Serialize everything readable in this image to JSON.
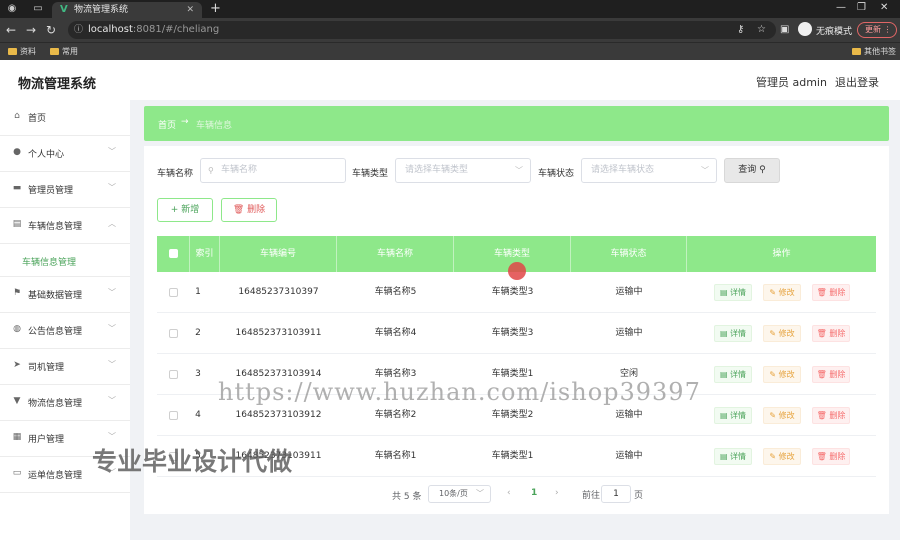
{
  "browser": {
    "tab_title": "物流管理系统",
    "url_host": "localhost",
    "url_path": ":8081/#/cheliang",
    "incognito_label": "无痕模式",
    "update_label": "更新",
    "bookmarks": [
      "资料",
      "常用",
      "其他书签"
    ]
  },
  "header": {
    "app_title": "物流管理系统",
    "user_label": "管理员 admin",
    "logout_label": "退出登录"
  },
  "sidebar": {
    "items": [
      {
        "label": "首页",
        "icon": "home-icon"
      },
      {
        "label": "个人中心",
        "icon": "user-icon"
      },
      {
        "label": "管理员管理",
        "icon": "briefcase-icon"
      },
      {
        "label": "车辆信息管理",
        "icon": "chat-icon"
      },
      {
        "label": "基础数据管理",
        "icon": "flag-icon"
      },
      {
        "label": "公告信息管理",
        "icon": "location-icon"
      },
      {
        "label": "司机管理",
        "icon": "send-icon"
      },
      {
        "label": "物流信息管理",
        "icon": "sign-icon"
      },
      {
        "label": "用户管理",
        "icon": "document-icon"
      },
      {
        "label": "运单信息管理",
        "icon": "ticket-icon"
      }
    ],
    "active_sub": "车辆信息管理"
  },
  "breadcrumb": {
    "home": "首页",
    "separator": "→",
    "current": "车辆信息"
  },
  "filters": {
    "name_label": "车辆名称",
    "name_placeholder": "车辆名称",
    "type_label": "车辆类型",
    "type_placeholder": "请选择车辆类型",
    "status_label": "车辆状态",
    "status_placeholder": "请选择车辆状态",
    "query_label": "查询"
  },
  "actions": {
    "add_label": "新增",
    "delete_label": "删除"
  },
  "table": {
    "headers": [
      "索引",
      "车辆编号",
      "车辆名称",
      "车辆类型",
      "车辆状态",
      "操作"
    ],
    "rows": [
      {
        "index": "1",
        "code": "16485237310397",
        "name": "车辆名称5",
        "type": "车辆类型3",
        "status": "运输中"
      },
      {
        "index": "2",
        "code": "164852373103911",
        "name": "车辆名称4",
        "type": "车辆类型3",
        "status": "运输中"
      },
      {
        "index": "3",
        "code": "164852373103914",
        "name": "车辆名称3",
        "type": "车辆类型1",
        "status": "空闲"
      },
      {
        "index": "4",
        "code": "164852373103912",
        "name": "车辆名称2",
        "type": "车辆类型2",
        "status": "运输中"
      },
      {
        "index": "5",
        "code": "164852373103911",
        "name": "车辆名称1",
        "type": "车辆类型1",
        "status": "运输中"
      }
    ],
    "row_actions": {
      "detail": "详情",
      "edit": "修改",
      "delete": "删除"
    }
  },
  "pagination": {
    "total_label": "共 5 条",
    "page_size": "10条/页",
    "current_page": "1",
    "goto_prefix": "前往",
    "goto_value": "1",
    "goto_suffix": "页"
  },
  "overlays": {
    "watermark_url": "https://www.huzhan.com/ishop39397",
    "watermark_ad": "专业毕业设计代做"
  },
  "colors": {
    "accent_green": "#8ee88a",
    "text_green": "#4aa35a",
    "edit_orange": "#e6a23c",
    "delete_red": "#f56c6c"
  }
}
